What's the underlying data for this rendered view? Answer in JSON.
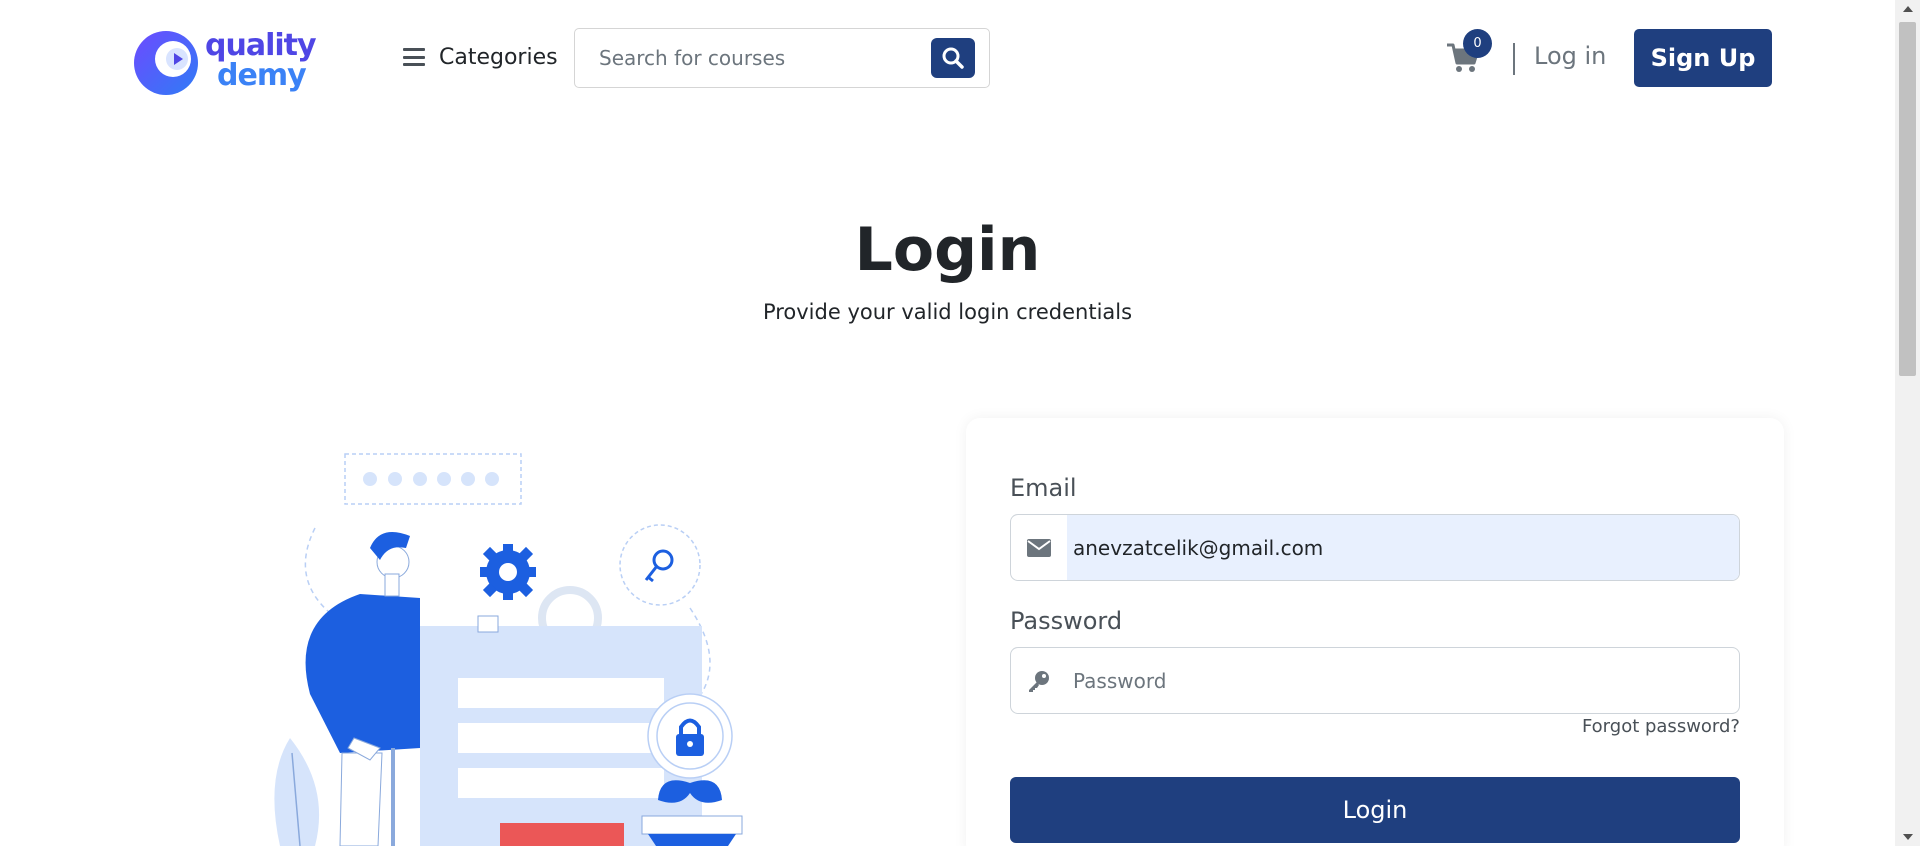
{
  "header": {
    "logo": {
      "line1": "quality",
      "line2": "demy"
    },
    "categories_label": "Categories",
    "search": {
      "placeholder": "Search for courses",
      "value": ""
    },
    "cart_count": "0",
    "login_label": "Log in",
    "signup_label": "Sign Up"
  },
  "hero": {
    "title": "Login",
    "subtitle": "Provide your valid login credentials"
  },
  "form": {
    "email": {
      "label": "Email",
      "value": "anevzatcelik@gmail.com",
      "placeholder": ""
    },
    "password": {
      "label": "Password",
      "placeholder": "Password",
      "value": ""
    },
    "forgot_label": "Forgot password?",
    "submit_label": "Login"
  },
  "colors": {
    "primary": "#1f3f7f",
    "illustration_blue": "#1c5fe0",
    "illustration_light": "#d6e4fb",
    "accent_red": "#eb5757",
    "input_autofill_bg": "#e8f0fe"
  },
  "icons": {
    "menu": "hamburger-icon",
    "search": "search-icon",
    "cart": "cart-icon",
    "email": "envelope-icon",
    "password": "key-icon"
  }
}
